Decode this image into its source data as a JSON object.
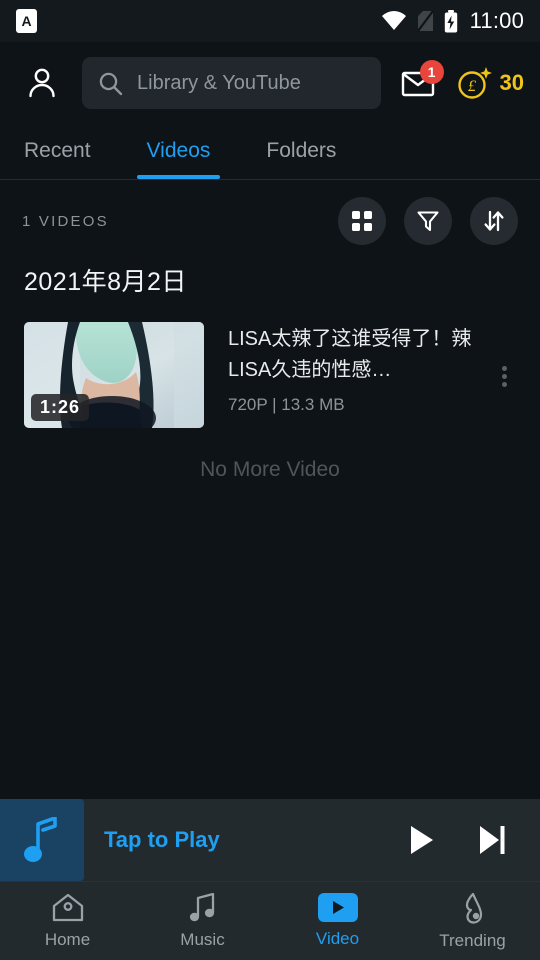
{
  "status_bar": {
    "app_badge_letter": "A",
    "time": "11:00",
    "icons": [
      "wifi-icon",
      "no-sim-icon",
      "battery-charging-icon"
    ]
  },
  "top_bar": {
    "profile_icon": "person-icon",
    "search": {
      "icon": "search-icon",
      "placeholder": "Library & YouTube",
      "value": ""
    },
    "mail": {
      "icon": "mail-icon",
      "badge": "1"
    },
    "coins": {
      "icon": "coin-icon",
      "symbol": "£",
      "count": "30",
      "color": "#f0c419"
    }
  },
  "tabs": {
    "items": [
      {
        "label": "Recent",
        "active": false
      },
      {
        "label": "Videos",
        "active": true
      },
      {
        "label": "Folders",
        "active": false
      }
    ],
    "accent_color": "#1e9ff2"
  },
  "list_toolbar": {
    "count_label": "1 VIDEOS",
    "actions": [
      {
        "name": "grid-view-icon",
        "label": "Grid view"
      },
      {
        "name": "filter-icon",
        "label": "Filter"
      },
      {
        "name": "sort-icon",
        "label": "Sort"
      }
    ]
  },
  "content": {
    "date_header": "2021年8月2日",
    "videos": [
      {
        "title": "LISA太辣了这谁受得了！辣LISA久违的性感…",
        "duration": "1:26",
        "resolution": "720P",
        "size": "13.3 MB",
        "meta": "720P | 13.3 MB"
      }
    ],
    "end_of_list": "No More Video"
  },
  "mini_player": {
    "art_icon": "music-note-icon",
    "title": "Tap to Play",
    "title_color": "#1e9ff2",
    "controls": [
      {
        "name": "play-button",
        "label": "Play"
      },
      {
        "name": "next-button",
        "label": "Next"
      }
    ]
  },
  "bottom_nav": {
    "items": [
      {
        "label": "Home",
        "icon": "home-icon",
        "active": false
      },
      {
        "label": "Music",
        "icon": "music-note-icon",
        "active": false
      },
      {
        "label": "Video",
        "icon": "video-play-icon",
        "active": true
      },
      {
        "label": "Trending",
        "icon": "flame-icon",
        "active": false
      }
    ],
    "active_color": "#1e9ff2"
  }
}
